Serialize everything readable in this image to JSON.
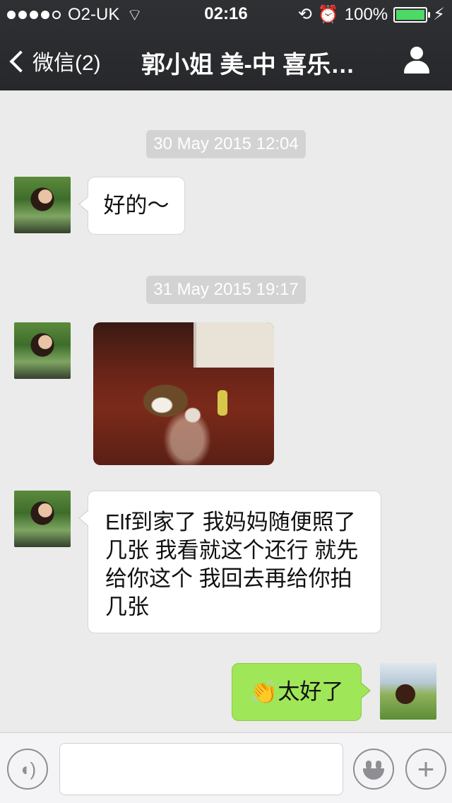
{
  "status_bar": {
    "carrier": "O2-UK",
    "time": "02:16",
    "battery": "100%",
    "signal_bars_filled": 4,
    "signal_bars_total": 5
  },
  "nav": {
    "back_label": "微信(2)",
    "title": "郭小姐 美-中 喜乐…",
    "icons": {
      "back": "chevron-left-icon",
      "profile": "person-icon"
    }
  },
  "chat": {
    "timestamps": [
      "30 May 2015 12:04",
      "31 May 2015 19:17"
    ],
    "messages": [
      {
        "side": "left",
        "type": "text",
        "text": "好的～"
      },
      {
        "side": "left",
        "type": "image",
        "image_desc": "dog-photo"
      },
      {
        "side": "left",
        "type": "text",
        "lines": [
          "Elf到家了 我妈妈随便照了",
          "几张 我看就这个还行 就先",
          "给你这个 我回去再给你拍",
          "几张"
        ]
      },
      {
        "side": "right",
        "type": "text",
        "emoji": "👏",
        "text": "太好了"
      }
    ]
  },
  "input_bar": {
    "text_value": "",
    "icons": {
      "voice": "voice-icon",
      "emoji": "smiley-icon",
      "more": "plus-icon"
    }
  },
  "colors": {
    "nav_bg": "#2b2c2f",
    "chat_bg": "#ebebeb",
    "outgoing_bubble": "#9fe658",
    "incoming_bubble": "#ffffff",
    "battery_fill": "#4cd964"
  }
}
